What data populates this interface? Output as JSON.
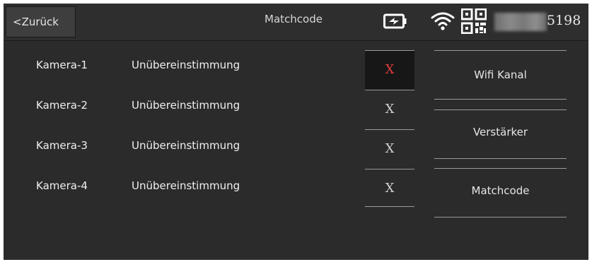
{
  "header": {
    "back_label": "<Zurück",
    "title": "Matchcode",
    "serial_suffix": "5198"
  },
  "icons": {
    "battery": "battery-charging-icon",
    "wifi": "wifi-icon",
    "qr": "qr-code-icon"
  },
  "cameras": [
    {
      "label": "Kamera-1",
      "status": "Unübereinstimmung",
      "action": "X"
    },
    {
      "label": "Kamera-2",
      "status": "Unübereinstimmung",
      "action": "X"
    },
    {
      "label": "Kamera-3",
      "status": "Unübereinstimmung",
      "action": "X"
    },
    {
      "label": "Kamera-4",
      "status": "Unübereinstimmung",
      "action": "X"
    }
  ],
  "menu": {
    "wifi_channel": "Wifi Kanal",
    "amplifier": "Verstärker",
    "matchcode": "Matchcode"
  },
  "colors": {
    "background": "#2b2b2b",
    "active_x": "#e23b3b",
    "text": "#f0f0f0"
  }
}
